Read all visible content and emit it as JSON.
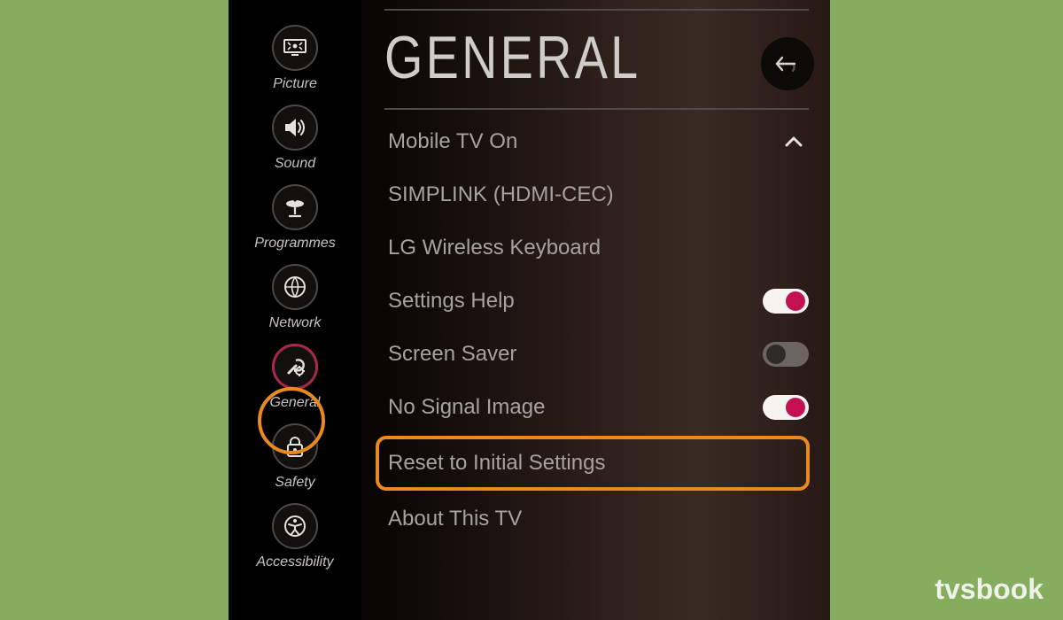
{
  "title": "GENERAL",
  "sidebar": [
    {
      "id": "picture",
      "label": "Picture",
      "icon": "picture-icon",
      "selected": false
    },
    {
      "id": "sound",
      "label": "Sound",
      "icon": "sound-icon",
      "selected": false
    },
    {
      "id": "programmes",
      "label": "Programmes",
      "icon": "satellite-icon",
      "selected": false
    },
    {
      "id": "network",
      "label": "Network",
      "icon": "globe-icon",
      "selected": false
    },
    {
      "id": "general",
      "label": "General",
      "icon": "wrench-gear-icon",
      "selected": true
    },
    {
      "id": "safety",
      "label": "Safety",
      "icon": "lock-icon",
      "selected": false
    },
    {
      "id": "accessibility",
      "label": "Accessibility",
      "icon": "accessibility-icon",
      "selected": false
    }
  ],
  "rows": [
    {
      "id": "mobile-tv-on",
      "label": "Mobile TV On",
      "kind": "submenu",
      "expanded": true
    },
    {
      "id": "simplink",
      "label": "SIMPLINK (HDMI-CEC)",
      "kind": "submenu"
    },
    {
      "id": "lg-wireless-keyboard",
      "label": "LG Wireless Keyboard",
      "kind": "submenu"
    },
    {
      "id": "settings-help",
      "label": "Settings Help",
      "kind": "toggle",
      "value": true
    },
    {
      "id": "screen-saver",
      "label": "Screen Saver",
      "kind": "toggle",
      "value": false
    },
    {
      "id": "no-signal-image",
      "label": "No Signal Image",
      "kind": "toggle",
      "value": true
    },
    {
      "id": "reset-to-initial",
      "label": "Reset to Initial Settings",
      "kind": "action",
      "highlighted": true
    },
    {
      "id": "about-this-tv",
      "label": "About This TV",
      "kind": "submenu"
    }
  ],
  "watermark": "tvsbook",
  "colors": {
    "accent": "#c41152",
    "highlight": "#e88a1f",
    "page_bg": "#86ad5d"
  }
}
